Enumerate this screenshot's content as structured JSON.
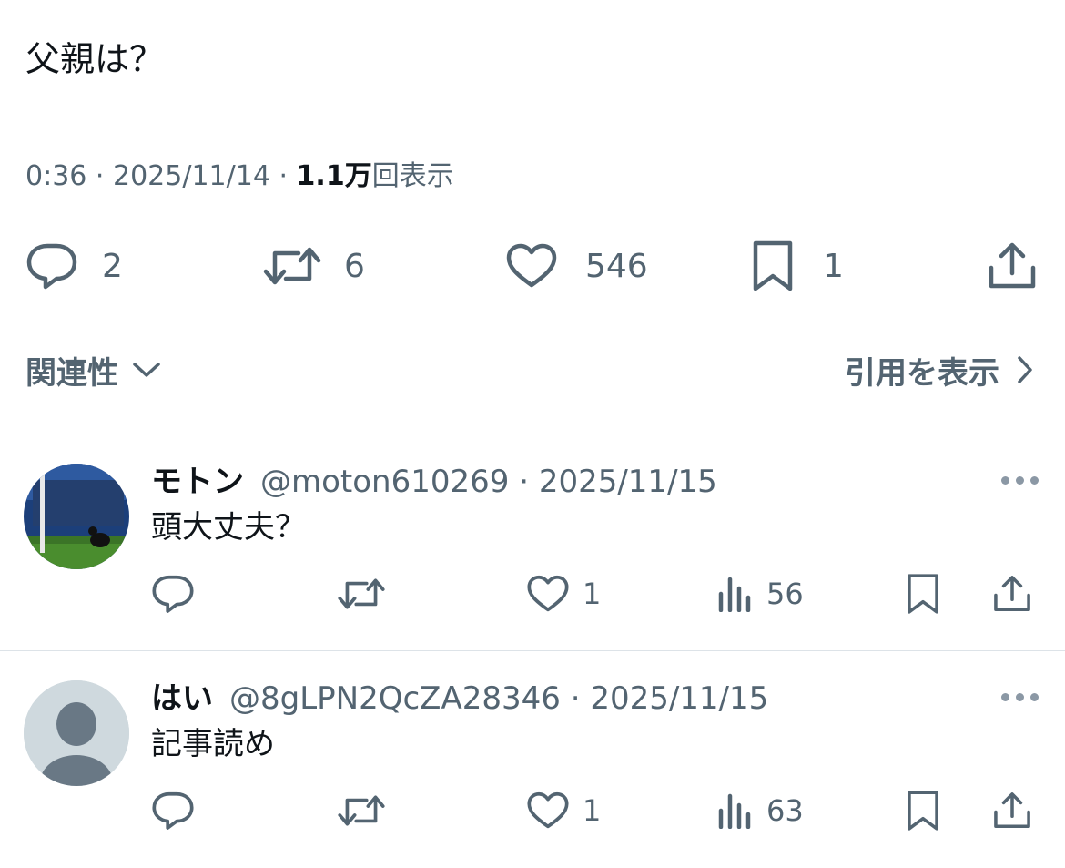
{
  "tweet": {
    "text": "父親は？",
    "time": "0:36",
    "sep": "·",
    "date": "2025/11/14",
    "views_count": "1.1万",
    "views_label": "回表示",
    "stats": {
      "replies": "2",
      "retweets": "6",
      "likes": "546",
      "bookmarks": "1"
    }
  },
  "sort": {
    "left_label": "関連性",
    "right_label": "引用を表示"
  },
  "replies": [
    {
      "name": "モトン",
      "handle": "@moton610269 · 2025/11/15",
      "text": "頭大丈夫？",
      "likes": "1",
      "views": "56"
    },
    {
      "name": "はい",
      "handle": "@8gLPN2QcZA28346 · 2025/11/15",
      "text": "記事読め",
      "likes": "1",
      "views": "63"
    }
  ],
  "colors": {
    "text": "#0f1419",
    "muted": "#536471",
    "divider": "#dde3e8",
    "default_avatar_bg": "#cfd9de"
  },
  "icons": [
    "reply-icon",
    "retweet-icon",
    "like-icon",
    "bookmark-icon",
    "share-icon",
    "chevron-down-icon",
    "chevron-right-icon",
    "views-icon",
    "more-icon"
  ]
}
